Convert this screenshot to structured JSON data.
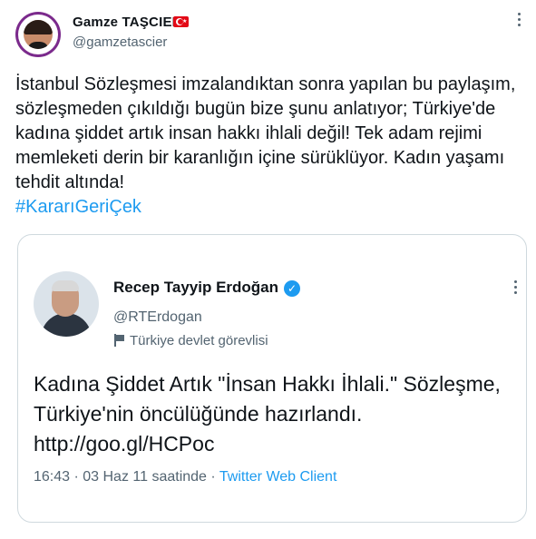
{
  "tweet": {
    "author_name": "Gamze TAŞCIER",
    "author_handle": "@gamzetascier",
    "body": "İstanbul Sözleşmesi imzalandıktan sonra yapılan bu paylaşım, sözleşmeden çıkıldığı bugün bize şunu anlatıyor; Türkiye'de kadına şiddet artık insan hakkı ihlali değil! Tek adam rejimi memleketi derin bir karanlığın içine sürüklüyor. Kadın yaşamı tehdit altında!",
    "hashtag": "#KararıGeriÇek"
  },
  "quoted": {
    "author_name": "Recep Tayyip Erdoğan",
    "author_handle": "@RTErdogan",
    "label": "Türkiye devlet görevlisi",
    "body": "Kadına Şiddet Artık \"İnsan Hakkı İhlali.\" Sözleşme, Türkiye'nin öncülüğünde hazırlandı. http://goo.gl/HCPoc",
    "time": "16:43 · 03 Haz 11 saatinde · ",
    "client": "Twitter Web Client"
  },
  "colors": {
    "link": "#1d9bf0",
    "secondary": "#536471",
    "verified": "#1d9bf0",
    "flag_red": "#e30a17"
  },
  "icons": [
    "turkey-flag-icon",
    "more-icon",
    "verified-icon",
    "flag-icon"
  ]
}
